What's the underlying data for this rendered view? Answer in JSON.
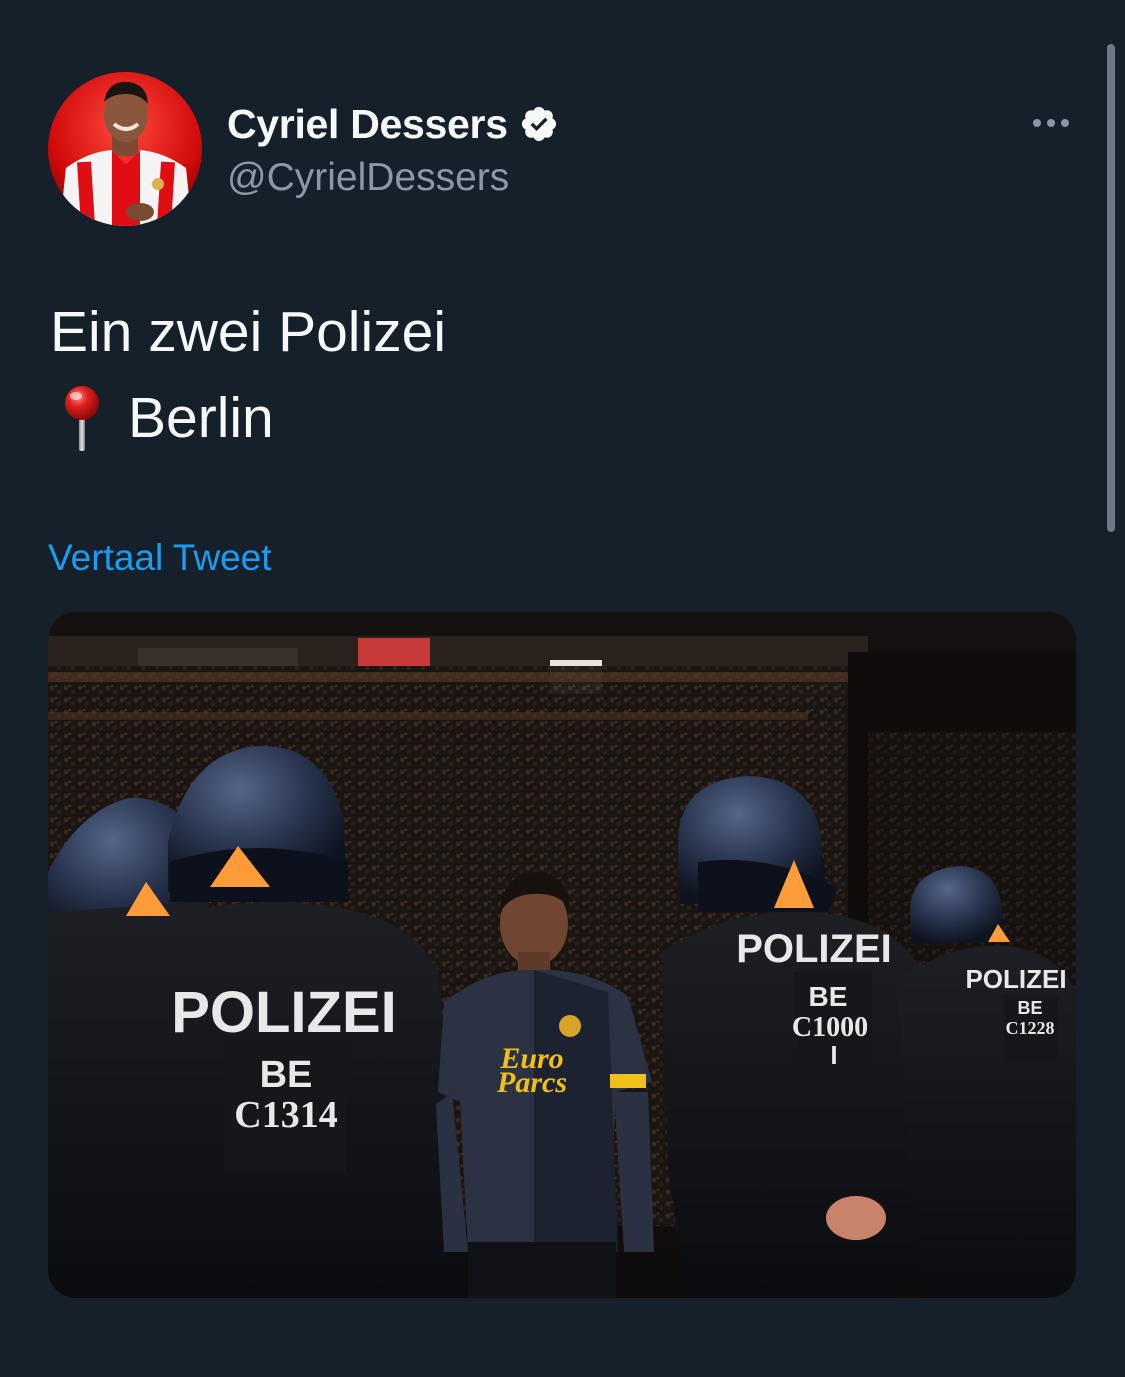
{
  "tweet": {
    "author": {
      "display_name": "Cyriel Dessers",
      "handle": "@CyrielDessers",
      "verified": true,
      "avatar": "profile-photo"
    },
    "text_line_1": "Ein zwei Polizei",
    "location_emoji": "round-pushpin-icon",
    "text_line_2": "Berlin",
    "translate_label": "Vertaal Tweet",
    "media": {
      "description": "photo",
      "signs": {
        "officer_left": {
          "unit": "POLIZEI",
          "code_line_1": "BE",
          "code_line_2": "C1314"
        },
        "officer_middle": {
          "unit": "POLIZEI",
          "code_line_1": "BE",
          "code_line_2": "C1000",
          "code_line_3": "I"
        },
        "officer_right": {
          "unit": "POLIZEI",
          "code_line_1": "BE",
          "code_line_2": "C1228"
        },
        "jersey_sponsor_1": "Euro",
        "jersey_sponsor_2": "Parcs"
      }
    }
  },
  "colors": {
    "background": "#15202b",
    "text_primary": "#f7f9f9",
    "text_secondary": "#8b98a5",
    "accent": "#1d9bf0"
  }
}
